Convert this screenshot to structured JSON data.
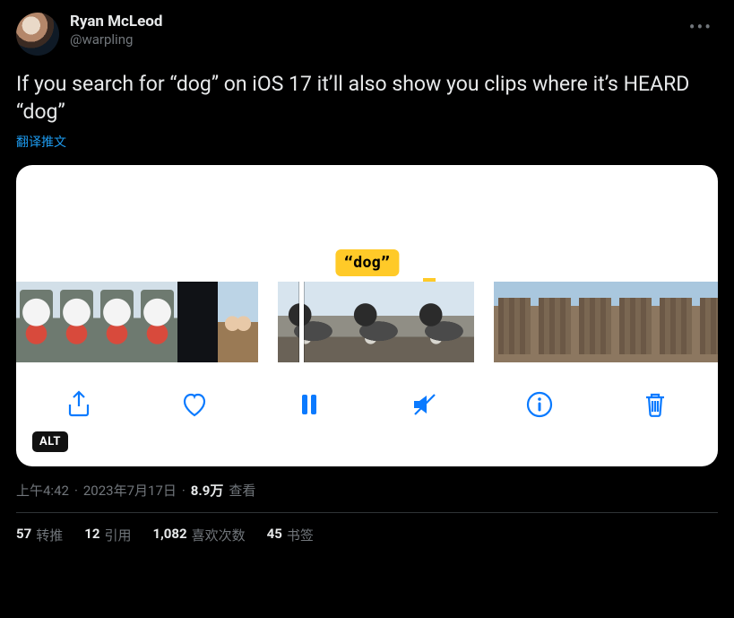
{
  "author": {
    "display_name": "Ryan McLeod",
    "handle": "@warpling"
  },
  "tweet_text": "If you search for “dog” on iOS 17 it’ll also show you clips where it’s HEARD “dog”",
  "translate_label": "翻译推文",
  "media": {
    "caption_chip": "“dog”",
    "alt_badge": "ALT",
    "toolbar": {
      "share": "share",
      "like": "like",
      "pause": "pause",
      "mute": "mute",
      "info": "info",
      "delete": "delete"
    }
  },
  "meta": {
    "time": "上午4:42",
    "sep": "·",
    "date": "2023年7月17日",
    "views_number": "8.9万",
    "views_label": "查看"
  },
  "stats": {
    "retweets": {
      "num": "57",
      "label": "转推"
    },
    "quotes": {
      "num": "12",
      "label": "引用"
    },
    "likes": {
      "num": "1,082",
      "label": "喜欢次数"
    },
    "bookmarks": {
      "num": "45",
      "label": "书签"
    }
  }
}
